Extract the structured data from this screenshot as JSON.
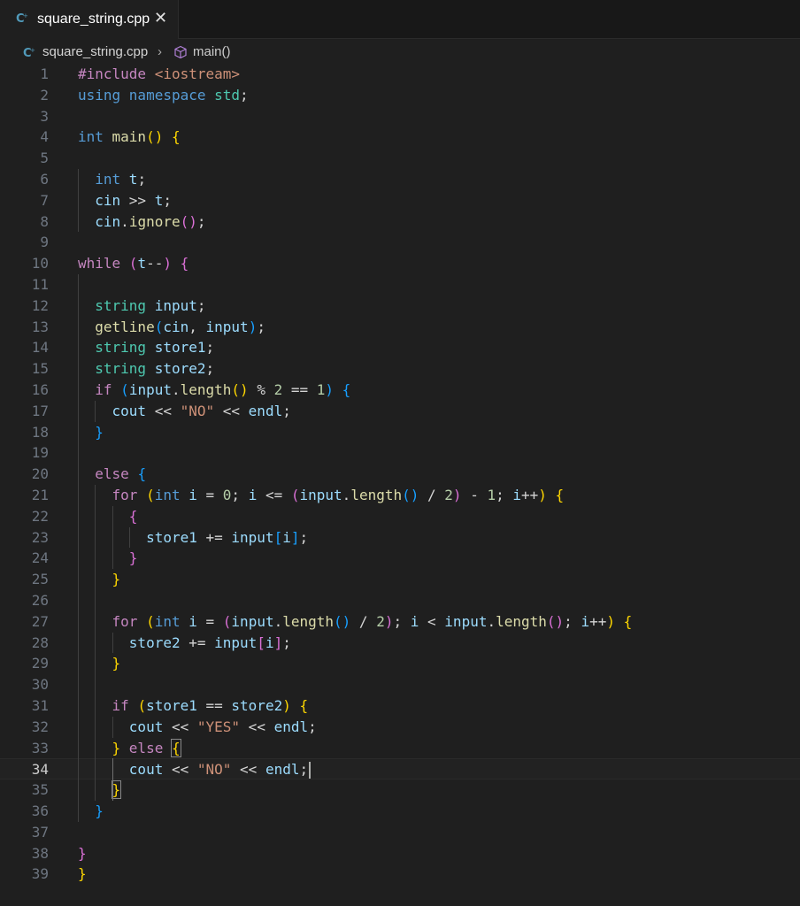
{
  "tab": {
    "filename": "square_string.cpp",
    "close_glyph": "✕",
    "icon": "cpp-file-icon"
  },
  "breadcrumbs": {
    "file": "square_string.cpp",
    "separator": "›",
    "function": "main()",
    "function_icon": "cube-icon"
  },
  "editor": {
    "active_line": 34,
    "lines": [
      {
        "n": "1",
        "t": [
          [
            "pp",
            "#include "
          ],
          [
            "inc",
            "<iostream>"
          ]
        ]
      },
      {
        "n": "2",
        "t": [
          [
            "kw",
            "using "
          ],
          [
            "kw",
            "namespace "
          ],
          [
            "ty",
            "std"
          ],
          [
            "op",
            ";"
          ]
        ]
      },
      {
        "n": "3",
        "t": []
      },
      {
        "n": "4",
        "t": [
          [
            "kw",
            "int "
          ],
          [
            "fn",
            "main"
          ],
          [
            "b1",
            "() {"
          ]
        ]
      },
      {
        "n": "5",
        "t": []
      },
      {
        "n": "6",
        "t": [
          [
            "op",
            "  "
          ],
          [
            "kw",
            "int "
          ],
          [
            "var",
            "t"
          ],
          [
            "op",
            ";"
          ]
        ]
      },
      {
        "n": "7",
        "t": [
          [
            "op",
            "  "
          ],
          [
            "var",
            "cin "
          ],
          [
            "op",
            ">> "
          ],
          [
            "var",
            "t"
          ],
          [
            "op",
            ";"
          ]
        ]
      },
      {
        "n": "8",
        "t": [
          [
            "op",
            "  "
          ],
          [
            "var",
            "cin"
          ],
          [
            "op",
            "."
          ],
          [
            "fn",
            "ignore"
          ],
          [
            "b2",
            "()"
          ],
          [
            "op",
            ";"
          ]
        ]
      },
      {
        "n": "9",
        "t": []
      },
      {
        "n": "10",
        "t": [
          [
            "ctl",
            "while "
          ],
          [
            "b2",
            "("
          ],
          [
            "var",
            "t"
          ],
          [
            "op",
            "--"
          ],
          [
            "b2",
            ") {"
          ]
        ]
      },
      {
        "n": "11",
        "t": []
      },
      {
        "n": "12",
        "t": [
          [
            "op",
            "  "
          ],
          [
            "ty",
            "string "
          ],
          [
            "var",
            "input"
          ],
          [
            "op",
            ";"
          ]
        ]
      },
      {
        "n": "13",
        "t": [
          [
            "op",
            "  "
          ],
          [
            "fn",
            "getline"
          ],
          [
            "b3",
            "("
          ],
          [
            "var",
            "cin"
          ],
          [
            "op",
            ", "
          ],
          [
            "var",
            "input"
          ],
          [
            "b3",
            ")"
          ],
          [
            "op",
            ";"
          ]
        ]
      },
      {
        "n": "14",
        "t": [
          [
            "op",
            "  "
          ],
          [
            "ty",
            "string "
          ],
          [
            "var",
            "store1"
          ],
          [
            "op",
            ";"
          ]
        ]
      },
      {
        "n": "15",
        "t": [
          [
            "op",
            "  "
          ],
          [
            "ty",
            "string "
          ],
          [
            "var",
            "store2"
          ],
          [
            "op",
            ";"
          ]
        ]
      },
      {
        "n": "16",
        "t": [
          [
            "op",
            "  "
          ],
          [
            "ctl",
            "if "
          ],
          [
            "b3",
            "("
          ],
          [
            "var",
            "input"
          ],
          [
            "op",
            "."
          ],
          [
            "fn",
            "length"
          ],
          [
            "b1",
            "()"
          ],
          [
            "op",
            " % "
          ],
          [
            "num",
            "2"
          ],
          [
            "op",
            " == "
          ],
          [
            "num",
            "1"
          ],
          [
            "b3",
            ") {"
          ]
        ]
      },
      {
        "n": "17",
        "t": [
          [
            "op",
            "    "
          ],
          [
            "var",
            "cout "
          ],
          [
            "op",
            "<< "
          ],
          [
            "str",
            "\"NO\""
          ],
          [
            "op",
            " << "
          ],
          [
            "var",
            "endl"
          ],
          [
            "op",
            ";"
          ]
        ]
      },
      {
        "n": "18",
        "t": [
          [
            "op",
            "  "
          ],
          [
            "b3",
            "}"
          ]
        ]
      },
      {
        "n": "19",
        "t": []
      },
      {
        "n": "20",
        "t": [
          [
            "op",
            "  "
          ],
          [
            "ctl",
            "else "
          ],
          [
            "b3",
            "{"
          ]
        ]
      },
      {
        "n": "21",
        "t": [
          [
            "op",
            "    "
          ],
          [
            "ctl",
            "for "
          ],
          [
            "b1",
            "("
          ],
          [
            "kw",
            "int "
          ],
          [
            "var",
            "i"
          ],
          [
            "op",
            " = "
          ],
          [
            "num",
            "0"
          ],
          [
            "op",
            "; "
          ],
          [
            "var",
            "i"
          ],
          [
            "op",
            " <= "
          ],
          [
            "b2",
            "("
          ],
          [
            "var",
            "input"
          ],
          [
            "op",
            "."
          ],
          [
            "fn",
            "length"
          ],
          [
            "b3",
            "()"
          ],
          [
            "op",
            " / "
          ],
          [
            "num",
            "2"
          ],
          [
            "b2",
            ")"
          ],
          [
            "op",
            " - "
          ],
          [
            "num",
            "1"
          ],
          [
            "op",
            "; "
          ],
          [
            "var",
            "i"
          ],
          [
            "op",
            "++"
          ],
          [
            "b1",
            ") {"
          ]
        ]
      },
      {
        "n": "22",
        "t": [
          [
            "op",
            "      "
          ],
          [
            "b2",
            "{"
          ]
        ]
      },
      {
        "n": "23",
        "t": [
          [
            "op",
            "        "
          ],
          [
            "var",
            "store1"
          ],
          [
            "op",
            " += "
          ],
          [
            "var",
            "input"
          ],
          [
            "b3",
            "["
          ],
          [
            "var",
            "i"
          ],
          [
            "b3",
            "]"
          ],
          [
            "op",
            ";"
          ]
        ]
      },
      {
        "n": "24",
        "t": [
          [
            "op",
            "      "
          ],
          [
            "b2",
            "}"
          ]
        ]
      },
      {
        "n": "25",
        "t": [
          [
            "op",
            "    "
          ],
          [
            "b1",
            "}"
          ]
        ]
      },
      {
        "n": "26",
        "t": []
      },
      {
        "n": "27",
        "t": [
          [
            "op",
            "    "
          ],
          [
            "ctl",
            "for "
          ],
          [
            "b1",
            "("
          ],
          [
            "kw",
            "int "
          ],
          [
            "var",
            "i"
          ],
          [
            "op",
            " = "
          ],
          [
            "b2",
            "("
          ],
          [
            "var",
            "input"
          ],
          [
            "op",
            "."
          ],
          [
            "fn",
            "length"
          ],
          [
            "b3",
            "()"
          ],
          [
            "op",
            " / "
          ],
          [
            "num",
            "2"
          ],
          [
            "b2",
            ")"
          ],
          [
            "op",
            "; "
          ],
          [
            "var",
            "i"
          ],
          [
            "op",
            " < "
          ],
          [
            "var",
            "input"
          ],
          [
            "op",
            "."
          ],
          [
            "fn",
            "length"
          ],
          [
            "b2",
            "()"
          ],
          [
            "op",
            "; "
          ],
          [
            "var",
            "i"
          ],
          [
            "op",
            "++"
          ],
          [
            "b1",
            ") {"
          ]
        ]
      },
      {
        "n": "28",
        "t": [
          [
            "op",
            "      "
          ],
          [
            "var",
            "store2"
          ],
          [
            "op",
            " += "
          ],
          [
            "var",
            "input"
          ],
          [
            "b2",
            "["
          ],
          [
            "var",
            "i"
          ],
          [
            "b2",
            "]"
          ],
          [
            "op",
            ";"
          ]
        ]
      },
      {
        "n": "29",
        "t": [
          [
            "op",
            "    "
          ],
          [
            "b1",
            "}"
          ]
        ]
      },
      {
        "n": "30",
        "t": []
      },
      {
        "n": "31",
        "t": [
          [
            "op",
            "    "
          ],
          [
            "ctl",
            "if "
          ],
          [
            "b1",
            "("
          ],
          [
            "var",
            "store1"
          ],
          [
            "op",
            " == "
          ],
          [
            "var",
            "store2"
          ],
          [
            "b1",
            ") {"
          ]
        ]
      },
      {
        "n": "32",
        "t": [
          [
            "op",
            "      "
          ],
          [
            "var",
            "cout "
          ],
          [
            "op",
            "<< "
          ],
          [
            "str",
            "\"YES\""
          ],
          [
            "op",
            " << "
          ],
          [
            "var",
            "endl"
          ],
          [
            "op",
            ";"
          ]
        ]
      },
      {
        "n": "33",
        "t": [
          [
            "op",
            "    "
          ],
          [
            "b1",
            "} "
          ],
          [
            "ctl",
            "else "
          ],
          [
            "b1m",
            "{"
          ]
        ]
      },
      {
        "n": "34",
        "t": [
          [
            "op",
            "      "
          ],
          [
            "var",
            "cout "
          ],
          [
            "op",
            "<< "
          ],
          [
            "str",
            "\"NO\""
          ],
          [
            "op",
            " << "
          ],
          [
            "var",
            "endl"
          ],
          [
            "op",
            ";"
          ],
          [
            "cur",
            ""
          ]
        ]
      },
      {
        "n": "35",
        "t": [
          [
            "op",
            "    "
          ],
          [
            "b1m",
            "}"
          ]
        ]
      },
      {
        "n": "36",
        "t": [
          [
            "op",
            "  "
          ],
          [
            "b3",
            "}"
          ]
        ]
      },
      {
        "n": "37",
        "t": []
      },
      {
        "n": "38",
        "t": [
          [
            "b2",
            "}"
          ]
        ]
      },
      {
        "n": "39",
        "t": [
          [
            "b1",
            "}"
          ]
        ]
      }
    ]
  }
}
